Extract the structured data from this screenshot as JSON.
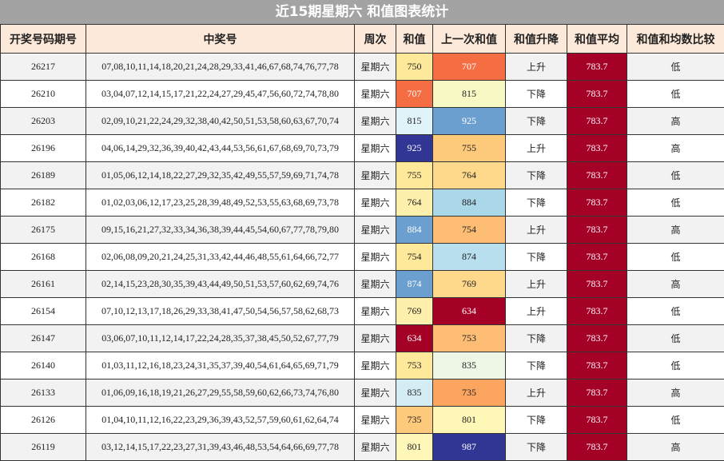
{
  "title": "近15期星期六 和值图表统计",
  "headers": [
    "开奖号码期号",
    "中奖号",
    "周次",
    "和值",
    "上一次和值",
    "和值升降",
    "和值平均",
    "和值和均数比较"
  ],
  "colors": {
    "header_bg": "#fde9d9",
    "title_bg": "#a3a3a3",
    "avg_bg": "#a50026",
    "row_alt_bg": "#f2f2f2"
  },
  "rows": [
    {
      "period": "26217",
      "numbers": "07,08,10,11,14,18,20,21,24,28,29,33,41,46,67,68,74,76,77,78",
      "weekday": "星期六",
      "sum": "750",
      "sum_bg": "#fee99b",
      "sum_fg": "#222222",
      "prev": "707",
      "prev_bg": "#f46d43",
      "prev_fg": "#ffffff",
      "trend": "上升",
      "avg": "783.7",
      "compare": "低"
    },
    {
      "period": "26210",
      "numbers": "03,04,07,12,14,15,17,21,22,24,27,29,45,47,56,60,72,74,78,80",
      "weekday": "星期六",
      "sum": "707",
      "sum_bg": "#f46d43",
      "sum_fg": "#ffffff",
      "prev": "815",
      "prev_bg": "#f7f8c4",
      "prev_fg": "#222222",
      "trend": "下降",
      "avg": "783.7",
      "compare": "低"
    },
    {
      "period": "26203",
      "numbers": "02,09,10,21,22,24,29,32,38,40,42,50,51,53,58,60,63,67,70,74",
      "weekday": "星期六",
      "sum": "815",
      "sum_bg": "#e0f3f8",
      "sum_fg": "#222222",
      "prev": "925",
      "prev_bg": "#6a9fd0",
      "prev_fg": "#ffffff",
      "trend": "下降",
      "avg": "783.7",
      "compare": "高"
    },
    {
      "period": "26196",
      "numbers": "04,06,14,29,32,36,39,40,42,43,44,53,56,61,67,68,69,70,73,79",
      "weekday": "星期六",
      "sum": "925",
      "sum_bg": "#313695",
      "sum_fg": "#ffffff",
      "prev": "755",
      "prev_bg": "#fdc97b",
      "prev_fg": "#222222",
      "trend": "上升",
      "avg": "783.7",
      "compare": "高"
    },
    {
      "period": "26189",
      "numbers": "01,05,06,12,14,18,22,27,29,32,35,42,49,55,57,59,69,71,74,78",
      "weekday": "星期六",
      "sum": "755",
      "sum_bg": "#fee99b",
      "sum_fg": "#222222",
      "prev": "764",
      "prev_bg": "#fed98b",
      "prev_fg": "#222222",
      "trend": "下降",
      "avg": "783.7",
      "compare": "低"
    },
    {
      "period": "26182",
      "numbers": "01,02,03,06,12,17,23,25,28,39,48,49,52,53,55,63,68,69,73,78",
      "weekday": "星期六",
      "sum": "764",
      "sum_bg": "#feefac",
      "sum_fg": "#222222",
      "prev": "884",
      "prev_bg": "#aad8e9",
      "prev_fg": "#222222",
      "trend": "下降",
      "avg": "783.7",
      "compare": "低"
    },
    {
      "period": "26175",
      "numbers": "09,15,16,21,27,32,33,34,36,38,39,44,45,54,60,67,77,78,79,80",
      "weekday": "星期六",
      "sum": "884",
      "sum_bg": "#6a9fd0",
      "sum_fg": "#ffffff",
      "prev": "754",
      "prev_bg": "#fdbd74",
      "prev_fg": "#222222",
      "trend": "上升",
      "avg": "783.7",
      "compare": "高"
    },
    {
      "period": "26168",
      "numbers": "02,06,08,09,20,21,24,25,31,33,42,44,46,48,55,61,64,66,72,77",
      "weekday": "星期六",
      "sum": "754",
      "sum_bg": "#fee99b",
      "sum_fg": "#222222",
      "prev": "874",
      "prev_bg": "#b7dfee",
      "prev_fg": "#222222",
      "trend": "下降",
      "avg": "783.7",
      "compare": "低"
    },
    {
      "period": "26161",
      "numbers": "02,14,15,23,28,30,35,39,43,44,49,50,51,53,57,60,62,69,74,76",
      "weekday": "星期六",
      "sum": "874",
      "sum_bg": "#6a9fd0",
      "sum_fg": "#ffffff",
      "prev": "769",
      "prev_bg": "#fed98b",
      "prev_fg": "#222222",
      "trend": "上升",
      "avg": "783.7",
      "compare": "高"
    },
    {
      "period": "26154",
      "numbers": "07,10,12,13,17,18,26,29,33,38,41,47,50,54,56,57,58,62,68,73",
      "weekday": "星期六",
      "sum": "769",
      "sum_bg": "#feefac",
      "sum_fg": "#222222",
      "prev": "634",
      "prev_bg": "#a50026",
      "prev_fg": "#ffffff",
      "trend": "上升",
      "avg": "783.7",
      "compare": "低"
    },
    {
      "period": "26147",
      "numbers": "03,06,07,10,11,12,14,17,22,24,28,35,37,38,45,50,52,67,77,79",
      "weekday": "星期六",
      "sum": "634",
      "sum_bg": "#a50026",
      "sum_fg": "#ffffff",
      "prev": "753",
      "prev_bg": "#fdbd74",
      "prev_fg": "#222222",
      "trend": "下降",
      "avg": "783.7",
      "compare": "低"
    },
    {
      "period": "26140",
      "numbers": "01,03,11,12,16,18,23,24,31,35,37,39,40,54,61,64,65,69,71,79",
      "weekday": "星期六",
      "sum": "753",
      "sum_bg": "#fee99b",
      "sum_fg": "#222222",
      "prev": "835",
      "prev_bg": "#eef6e5",
      "prev_fg": "#222222",
      "trend": "下降",
      "avg": "783.7",
      "compare": "低"
    },
    {
      "period": "26133",
      "numbers": "01,06,09,16,18,19,21,26,27,29,55,58,59,60,62,66,73,74,76,80",
      "weekday": "星期六",
      "sum": "835",
      "sum_bg": "#d4ecf3",
      "sum_fg": "#222222",
      "prev": "735",
      "prev_bg": "#fca55e",
      "prev_fg": "#222222",
      "trend": "上升",
      "avg": "783.7",
      "compare": "高"
    },
    {
      "period": "26126",
      "numbers": "01,04,10,11,12,16,22,23,29,36,39,43,52,57,59,60,61,62,64,74",
      "weekday": "星期六",
      "sum": "735",
      "sum_bg": "#fdc97b",
      "sum_fg": "#222222",
      "prev": "801",
      "prev_bg": "#fff7b8",
      "prev_fg": "#222222",
      "trend": "下降",
      "avg": "783.7",
      "compare": "低"
    },
    {
      "period": "26119",
      "numbers": "03,12,14,15,17,22,23,27,31,39,43,46,48,53,54,64,66,69,77,78",
      "weekday": "星期六",
      "sum": "801",
      "sum_bg": "#fff7b8",
      "sum_fg": "#222222",
      "prev": "987",
      "prev_bg": "#313695",
      "prev_fg": "#ffffff",
      "trend": "下降",
      "avg": "783.7",
      "compare": "高"
    }
  ],
  "chart_data": {
    "type": "table",
    "title": "近15期星期六 和值图表统计",
    "columns": [
      "开奖号码期号",
      "中奖号",
      "周次",
      "和值",
      "上一次和值",
      "和值升降",
      "和值平均",
      "和值和均数比较"
    ],
    "x": [
      "26217",
      "26210",
      "26203",
      "26196",
      "26189",
      "26182",
      "26175",
      "26168",
      "26161",
      "26154",
      "26147",
      "26140",
      "26133",
      "26126",
      "26119"
    ],
    "series": [
      {
        "name": "和值",
        "values": [
          750,
          707,
          815,
          925,
          755,
          764,
          884,
          754,
          874,
          769,
          634,
          753,
          835,
          735,
          801
        ]
      },
      {
        "name": "上一次和值",
        "values": [
          707,
          815,
          925,
          755,
          764,
          884,
          754,
          874,
          769,
          634,
          753,
          835,
          735,
          801,
          987
        ]
      },
      {
        "name": "和值平均",
        "values": [
          783.7,
          783.7,
          783.7,
          783.7,
          783.7,
          783.7,
          783.7,
          783.7,
          783.7,
          783.7,
          783.7,
          783.7,
          783.7,
          783.7,
          783.7
        ]
      }
    ]
  }
}
